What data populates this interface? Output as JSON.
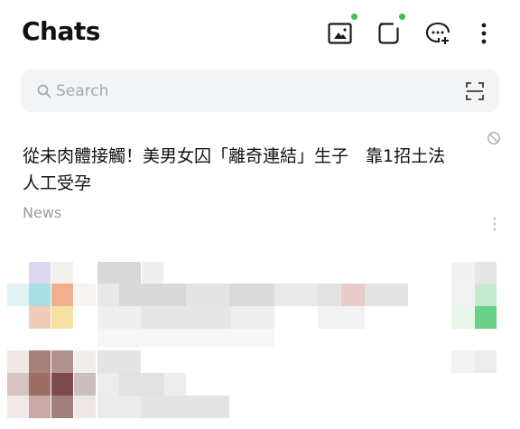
{
  "header": {
    "title": "Chats"
  },
  "search": {
    "placeholder": "Search"
  },
  "news": {
    "headline": "從未肉體接觸！美男女囚「離奇連結」生子　靠1招土法人工受孕",
    "source": "News"
  },
  "icons": {
    "album": "album-icon",
    "square": "square-chat-icon",
    "new_chat": "new-chat-icon",
    "more": "more-vertical-icon",
    "scan": "scan-icon",
    "mute": "mute-icon",
    "search": "search-icon"
  },
  "colors": {
    "notification_dot": "#2fc454"
  }
}
